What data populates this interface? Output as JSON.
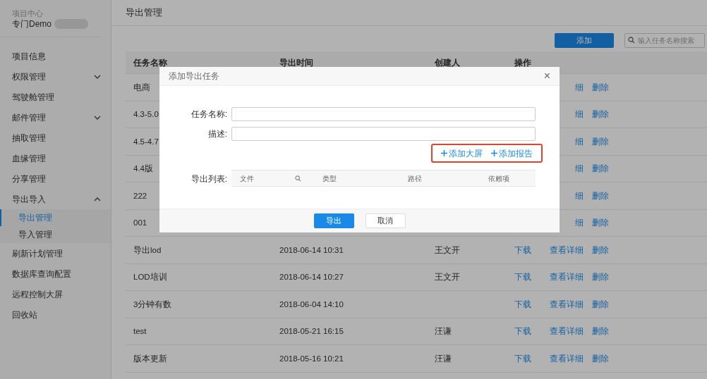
{
  "sidebar": {
    "project_label": "项目中心",
    "project_name": "专门Demo",
    "items": [
      {
        "label": "项目信息"
      },
      {
        "label": "权限管理",
        "expanded": false
      },
      {
        "label": "驾驶舱管理"
      },
      {
        "label": "邮件管理",
        "expanded": false
      },
      {
        "label": "抽取管理"
      },
      {
        "label": "血缘管理"
      },
      {
        "label": "分享管理"
      },
      {
        "label": "导出导入",
        "expanded": true,
        "children": [
          {
            "label": "导出管理",
            "selected": true
          },
          {
            "label": "导入管理",
            "selected": false
          }
        ]
      },
      {
        "label": "刷新计划管理"
      },
      {
        "label": "数据库查询配置"
      },
      {
        "label": "远程控制大屏"
      },
      {
        "label": "回收站"
      }
    ]
  },
  "page_title": "导出管理",
  "add_button": "添加",
  "search": {
    "placeholder": "输入任务名称搜索"
  },
  "table": {
    "columns": [
      "任务名称",
      "导出时间",
      "创建人",
      "操作"
    ],
    "rows": [
      {
        "name": "电商",
        "actions": [
          {
            "kind": "details",
            "label": "细"
          },
          {
            "kind": "delete",
            "label": "删除"
          }
        ]
      },
      {
        "name": "4.3-5.0",
        "actions": [
          {
            "kind": "details",
            "label": "细"
          },
          {
            "kind": "delete",
            "label": "删除"
          }
        ]
      },
      {
        "name": "4.5-4.7",
        "actions": [
          {
            "kind": "details",
            "label": "细"
          },
          {
            "kind": "delete",
            "label": "删除"
          }
        ]
      },
      {
        "name": "4.4版",
        "actions": [
          {
            "kind": "details",
            "label": "细"
          },
          {
            "kind": "delete",
            "label": "删除"
          }
        ]
      },
      {
        "name": "222",
        "actions": [
          {
            "kind": "details",
            "label": "细"
          },
          {
            "kind": "delete",
            "label": "删除"
          }
        ]
      },
      {
        "name": "001",
        "actions": [
          {
            "kind": "details",
            "label": "细"
          },
          {
            "kind": "delete",
            "label": "删除"
          }
        ]
      },
      {
        "name": "导出lod",
        "time": "2018-06-14 10:31",
        "creator": "王文开",
        "actions": [
          {
            "kind": "download",
            "label": "下载"
          },
          {
            "kind": "details",
            "label": "查看详细"
          },
          {
            "kind": "delete",
            "label": "删除"
          }
        ]
      },
      {
        "name": "LOD培训",
        "time": "2018-06-14 10:27",
        "creator": "王文开",
        "actions": [
          {
            "kind": "download",
            "label": "下载"
          },
          {
            "kind": "details",
            "label": "查看详细"
          },
          {
            "kind": "delete",
            "label": "删除"
          }
        ]
      },
      {
        "name": "3分钟有数",
        "time": "2018-06-04 14:10",
        "actions": [
          {
            "kind": "download",
            "label": "下载"
          },
          {
            "kind": "details",
            "label": "查看详细"
          },
          {
            "kind": "delete",
            "label": "删除"
          }
        ]
      },
      {
        "name": "test",
        "time": "2018-05-21 16:15",
        "creator": "汪谦",
        "actions": [
          {
            "kind": "download",
            "label": "下载"
          },
          {
            "kind": "details",
            "label": "查看详细"
          },
          {
            "kind": "delete",
            "label": "删除"
          }
        ]
      },
      {
        "name": "版本更新",
        "time": "2018-05-16 10:21",
        "creator": "汪谦",
        "actions": [
          {
            "kind": "download",
            "label": "下载"
          },
          {
            "kind": "details",
            "label": "查看详细"
          },
          {
            "kind": "delete",
            "label": "删除"
          }
        ]
      }
    ]
  },
  "dialog": {
    "title": "添加导出任务",
    "close": "×",
    "fields": [
      {
        "label": "任务名称:"
      },
      {
        "label": "描述:"
      }
    ],
    "add_links": [
      "添加大屏",
      "添加报告"
    ],
    "list_label": "导出列表:",
    "list_columns": [
      "文件",
      "类型",
      "路径",
      "依赖项"
    ],
    "buttons": [
      {
        "label": "导出",
        "kind": "primary"
      },
      {
        "label": "取消",
        "kind": "secondary"
      }
    ]
  }
}
